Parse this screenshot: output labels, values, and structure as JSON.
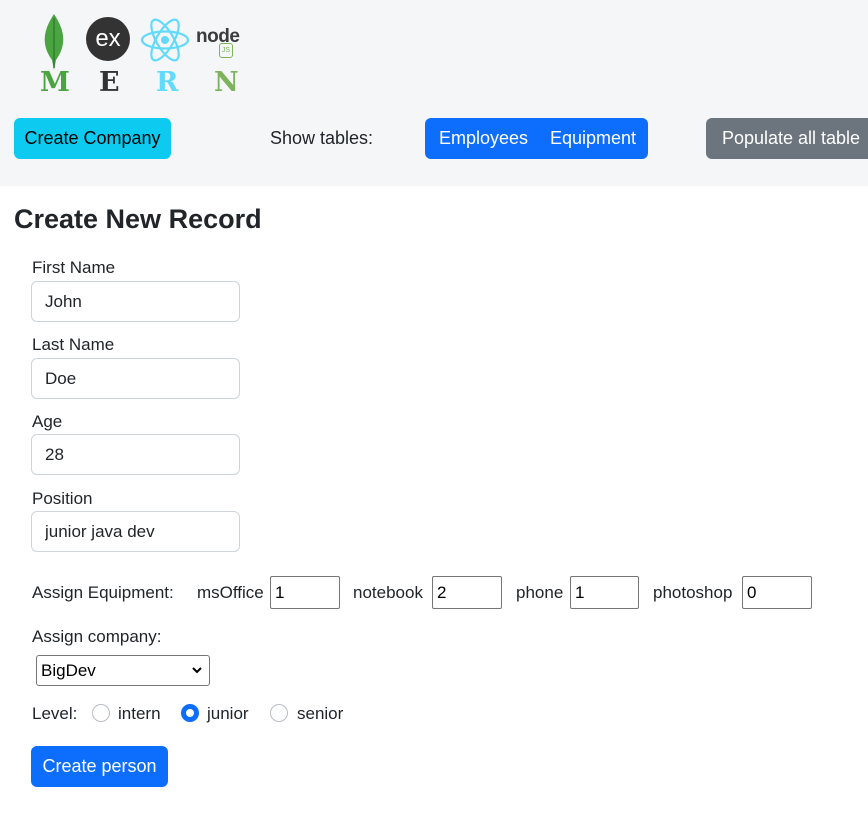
{
  "header": {
    "logos": [
      {
        "icon": "mongodb-leaf-icon",
        "letter": "M",
        "color": "#4aa540"
      },
      {
        "icon": "express-ex-icon",
        "letter": "E",
        "color": "#333333"
      },
      {
        "icon": "react-atom-icon",
        "letter": "R",
        "color": "#61dafb"
      },
      {
        "icon": "nodejs-icon",
        "letter": "N",
        "color": "#7db35b"
      }
    ],
    "node_logo_text": "node",
    "node_logo_badge": "JS",
    "express_logo_text": "ex",
    "create_company_label": "Create Company",
    "show_tables_label": "Show tables:",
    "table_buttons": [
      "Employees",
      "Equipment"
    ],
    "populate_label": "Populate all table"
  },
  "form": {
    "title": "Create New Record",
    "fields": [
      {
        "label": "First Name",
        "value": "John"
      },
      {
        "label": "Last Name",
        "value": "Doe"
      },
      {
        "label": "Age",
        "value": "28"
      },
      {
        "label": "Position",
        "value": "junior java dev"
      }
    ],
    "equipment": {
      "label": "Assign Equipment:",
      "items": [
        {
          "name": "msOffice",
          "value": "1"
        },
        {
          "name": "notebook",
          "value": "2"
        },
        {
          "name": "phone",
          "value": "1"
        },
        {
          "name": "photoshop",
          "value": "0"
        }
      ]
    },
    "company": {
      "label": "Assign company:",
      "selected": "BigDev"
    },
    "level": {
      "label": "Level:",
      "options": [
        "intern",
        "junior",
        "senior"
      ],
      "selected": "junior"
    },
    "submit_label": "Create person"
  },
  "colors": {
    "primary": "#0d6efd",
    "info": "#0dcaf0",
    "secondary": "#6c757d",
    "header_bg": "#f4f6f8"
  }
}
